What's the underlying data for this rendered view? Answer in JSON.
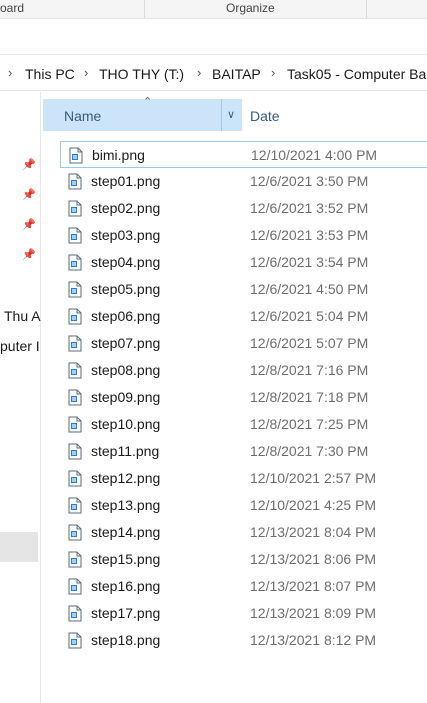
{
  "ribbon": {
    "group_left": "oard",
    "group_organize": "Organize"
  },
  "address": {
    "crumbs": [
      "This PC",
      "THO THY (T:)",
      "BAITAP",
      "Task05 - Computer Ba"
    ]
  },
  "nav": {
    "items": [
      "Thu A",
      "puter I"
    ]
  },
  "columns": {
    "name": "Name",
    "date": "Date"
  },
  "files": [
    {
      "name": "bimi.png",
      "date": "12/10/2021 4:00 PM"
    },
    {
      "name": "step01.png",
      "date": "12/6/2021 3:50 PM"
    },
    {
      "name": "step02.png",
      "date": "12/6/2021 3:52 PM"
    },
    {
      "name": "step03.png",
      "date": "12/6/2021 3:53 PM"
    },
    {
      "name": "step04.png",
      "date": "12/6/2021 3:54 PM"
    },
    {
      "name": "step05.png",
      "date": "12/6/2021 4:50 PM"
    },
    {
      "name": "step06.png",
      "date": "12/6/2021 5:04 PM"
    },
    {
      "name": "step07.png",
      "date": "12/6/2021 5:07 PM"
    },
    {
      "name": "step08.png",
      "date": "12/8/2021 7:16 PM"
    },
    {
      "name": "step09.png",
      "date": "12/8/2021 7:18 PM"
    },
    {
      "name": "step10.png",
      "date": "12/8/2021 7:25 PM"
    },
    {
      "name": "step11.png",
      "date": "12/8/2021 7:30 PM"
    },
    {
      "name": "step12.png",
      "date": "12/10/2021 2:57 PM"
    },
    {
      "name": "step13.png",
      "date": "12/10/2021 4:25 PM"
    },
    {
      "name": "step14.png",
      "date": "12/13/2021 8:04 PM"
    },
    {
      "name": "step15.png",
      "date": "12/13/2021 8:06 PM"
    },
    {
      "name": "step16.png",
      "date": "12/13/2021 8:07 PM"
    },
    {
      "name": "step17.png",
      "date": "12/13/2021 8:09 PM"
    },
    {
      "name": "step18.png",
      "date": "12/13/2021 8:12 PM"
    }
  ]
}
